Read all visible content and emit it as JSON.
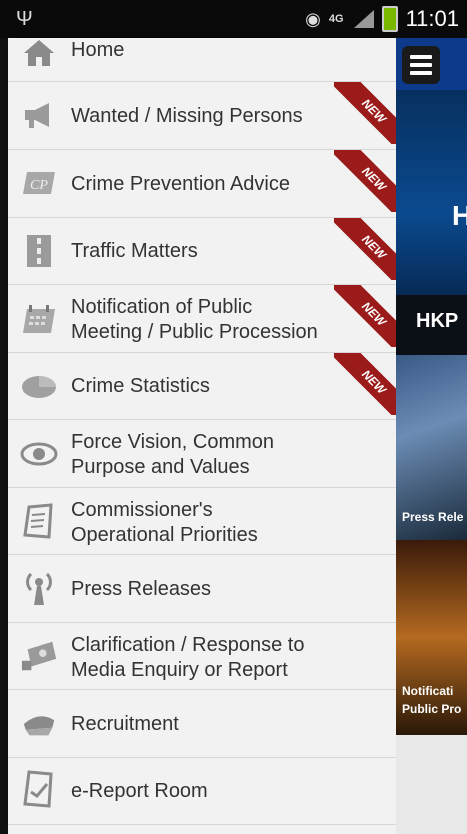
{
  "status_bar": {
    "left_icon": "usb-icon",
    "network": "4G",
    "time": "11:01"
  },
  "menu": {
    "items": [
      {
        "label": "Home",
        "icon": "home-icon",
        "new": false
      },
      {
        "label": "Wanted / Missing Persons",
        "icon": "megaphone-icon",
        "new": true
      },
      {
        "label": "Crime Prevention Advice",
        "icon": "cp-logo-icon",
        "new": true
      },
      {
        "label": "Traffic Matters",
        "icon": "road-icon",
        "new": true
      },
      {
        "label": "Notification of Public\nMeeting / Public Procession",
        "icon": "calendar-icon",
        "new": true
      },
      {
        "label": "Crime Statistics",
        "icon": "pie-chart-icon",
        "new": true
      },
      {
        "label": "Force Vision, Common\nPurpose and Values",
        "icon": "eye-icon",
        "new": false
      },
      {
        "label": "Commissioner's\nOperational Priorities",
        "icon": "clipboard-icon",
        "new": false
      },
      {
        "label": "Press Releases",
        "icon": "broadcast-icon",
        "new": false
      },
      {
        "label": "Clarification / Response to\nMedia Enquiry or Report",
        "icon": "camera-icon",
        "new": false
      },
      {
        "label": "Recruitment",
        "icon": "police-cap-icon",
        "new": false
      },
      {
        "label": "e-Report Room",
        "icon": "report-icon",
        "new": false
      }
    ],
    "new_badge": "NEW"
  },
  "right_panel": {
    "hkp_text": "HKP",
    "badge_char": "H",
    "caption1": "Press Rele",
    "caption2_line1": "Notificati",
    "caption2_line2": "Public Pro"
  },
  "colors": {
    "drawer_bg": "#f2f2f2",
    "ribbon": "#9b1b1b",
    "text": "#333333"
  }
}
